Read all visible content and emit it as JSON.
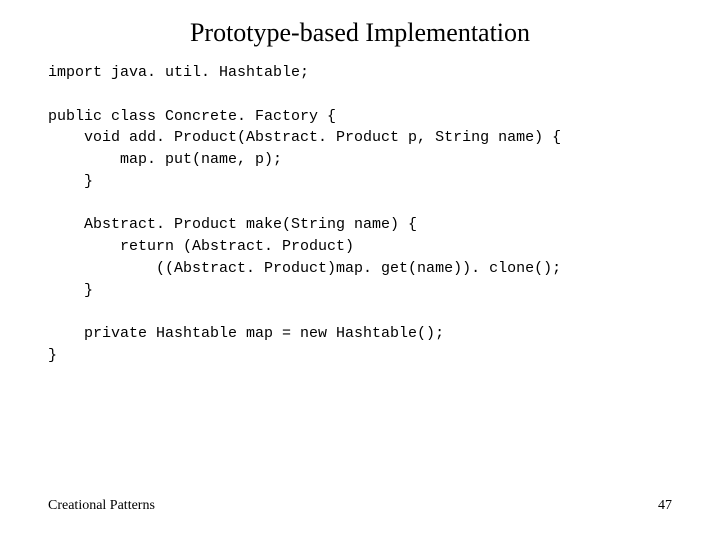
{
  "title": "Prototype-based Implementation",
  "code": "import java. util. Hashtable;\n\npublic class Concrete. Factory {\n    void add. Product(Abstract. Product p, String name) {\n        map. put(name, p);\n    }\n\n    Abstract. Product make(String name) {\n        return (Abstract. Product)\n            ((Abstract. Product)map. get(name)). clone();\n    }\n\n    private Hashtable map = new Hashtable();\n}",
  "footer_left": "Creational Patterns",
  "footer_right": "47"
}
